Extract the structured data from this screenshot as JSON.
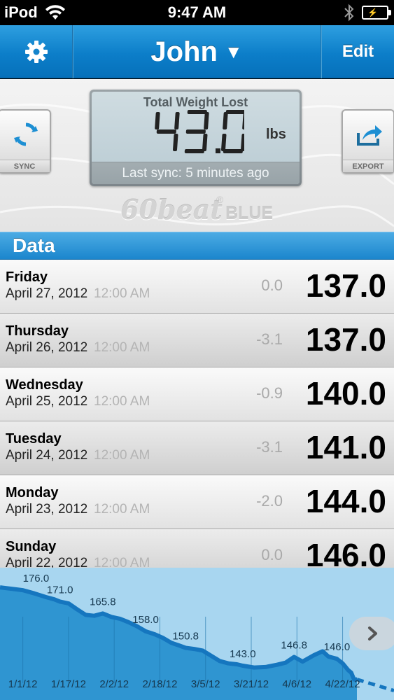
{
  "status_bar": {
    "carrier": "iPod",
    "time": "9:47 AM"
  },
  "nav": {
    "title": "John",
    "title_caret": "▼",
    "edit_label": "Edit"
  },
  "summary": {
    "title": "Total Weight Lost",
    "value": "43.0",
    "unit": "lbs",
    "last_sync": "Last sync: 5 minutes ago"
  },
  "buttons": {
    "sync_label": "SYNC",
    "export_label": "EXPORT"
  },
  "logo": {
    "text": "60beat",
    "suffix": "BLUE",
    "mark": "®"
  },
  "section": {
    "title": "Data"
  },
  "entries": [
    {
      "day": "Friday",
      "date": "April 27, 2012",
      "time": "12:00 AM",
      "change": "0.0",
      "weight": "137.0"
    },
    {
      "day": "Thursday",
      "date": "April 26, 2012",
      "time": "12:00 AM",
      "change": "-3.1",
      "weight": "137.0"
    },
    {
      "day": "Wednesday",
      "date": "April 25, 2012",
      "time": "12:00 AM",
      "change": "-0.9",
      "weight": "140.0"
    },
    {
      "day": "Tuesday",
      "date": "April 24, 2012",
      "time": "12:00 AM",
      "change": "-3.1",
      "weight": "141.0"
    },
    {
      "day": "Monday",
      "date": "April 23, 2012",
      "time": "12:00 AM",
      "change": "-2.0",
      "weight": "144.0"
    },
    {
      "day": "Sunday",
      "date": "April 22, 2012",
      "time": "12:00 AM",
      "change": "0.0",
      "weight": "146.0"
    }
  ],
  "colors": {
    "accent": "#0c7ec9",
    "chart_fill": "#2f95d1",
    "chart_line": "#1576bf",
    "chart_bg": "#a8d6f0"
  },
  "chart_data": {
    "type": "area",
    "x_ticks": [
      "1/1/12",
      "1/17/12",
      "2/2/12",
      "2/18/12",
      "3/5/12",
      "3/21/12",
      "4/6/12",
      "4/22/12"
    ],
    "peak_labels": [
      {
        "date": "2012-01-01",
        "value": 176.0,
        "label": "176.0"
      },
      {
        "date": "2012-01-14",
        "value": 171.0,
        "label": "171.0"
      },
      {
        "date": "2012-01-29",
        "value": 165.8,
        "label": "165.8"
      },
      {
        "date": "2012-02-13",
        "value": 158.0,
        "label": "158.0"
      },
      {
        "date": "2012-02-27",
        "value": 150.8,
        "label": "150.8"
      },
      {
        "date": "2012-03-18",
        "value": 143.0,
        "label": "143.0"
      },
      {
        "date": "2012-04-05",
        "value": 146.8,
        "label": "146.8"
      },
      {
        "date": "2012-04-20",
        "value": 146.0,
        "label": "146.0"
      }
    ],
    "series": [
      {
        "points": [
          [
            "2012-01-01",
            176.0
          ],
          [
            "2012-01-05",
            174.6
          ],
          [
            "2012-01-09",
            173.0
          ],
          [
            "2012-01-12",
            172.0
          ],
          [
            "2012-01-14",
            171.0
          ],
          [
            "2012-01-17",
            170.2
          ],
          [
            "2012-01-20",
            167.6
          ],
          [
            "2012-01-23",
            165.2
          ],
          [
            "2012-01-26",
            164.8
          ],
          [
            "2012-01-29",
            165.8
          ],
          [
            "2012-02-01",
            164.3
          ],
          [
            "2012-02-04",
            163.5
          ],
          [
            "2012-02-07",
            162.0
          ],
          [
            "2012-02-10",
            160.2
          ],
          [
            "2012-02-13",
            158.0
          ],
          [
            "2012-02-16",
            156.8
          ],
          [
            "2012-02-19",
            155.2
          ],
          [
            "2012-02-22",
            153.0
          ],
          [
            "2012-02-25",
            151.7
          ],
          [
            "2012-02-27",
            150.8
          ],
          [
            "2012-03-01",
            150.3
          ],
          [
            "2012-03-04",
            149.6
          ],
          [
            "2012-03-07",
            147.3
          ],
          [
            "2012-03-10",
            145.0
          ],
          [
            "2012-03-13",
            144.0
          ],
          [
            "2012-03-16",
            143.6
          ],
          [
            "2012-03-18",
            143.0
          ],
          [
            "2012-03-22",
            142.2
          ],
          [
            "2012-03-26",
            142.4
          ],
          [
            "2012-03-30",
            143.4
          ],
          [
            "2012-04-02",
            144.3
          ],
          [
            "2012-04-05",
            146.8
          ],
          [
            "2012-04-08",
            144.8
          ],
          [
            "2012-04-12",
            147.6
          ],
          [
            "2012-04-15",
            149.3
          ],
          [
            "2012-04-17",
            147.0
          ],
          [
            "2012-04-20",
            146.0
          ],
          [
            "2012-04-22",
            144.0
          ],
          [
            "2012-04-24",
            141.0
          ],
          [
            "2012-04-25",
            140.0
          ],
          [
            "2012-04-26",
            137.0
          ],
          [
            "2012-04-27",
            137.0
          ]
        ]
      }
    ],
    "xlim": [
      "2011-12-24",
      "2012-05-10"
    ],
    "ylim": [
      128,
      180
    ]
  }
}
